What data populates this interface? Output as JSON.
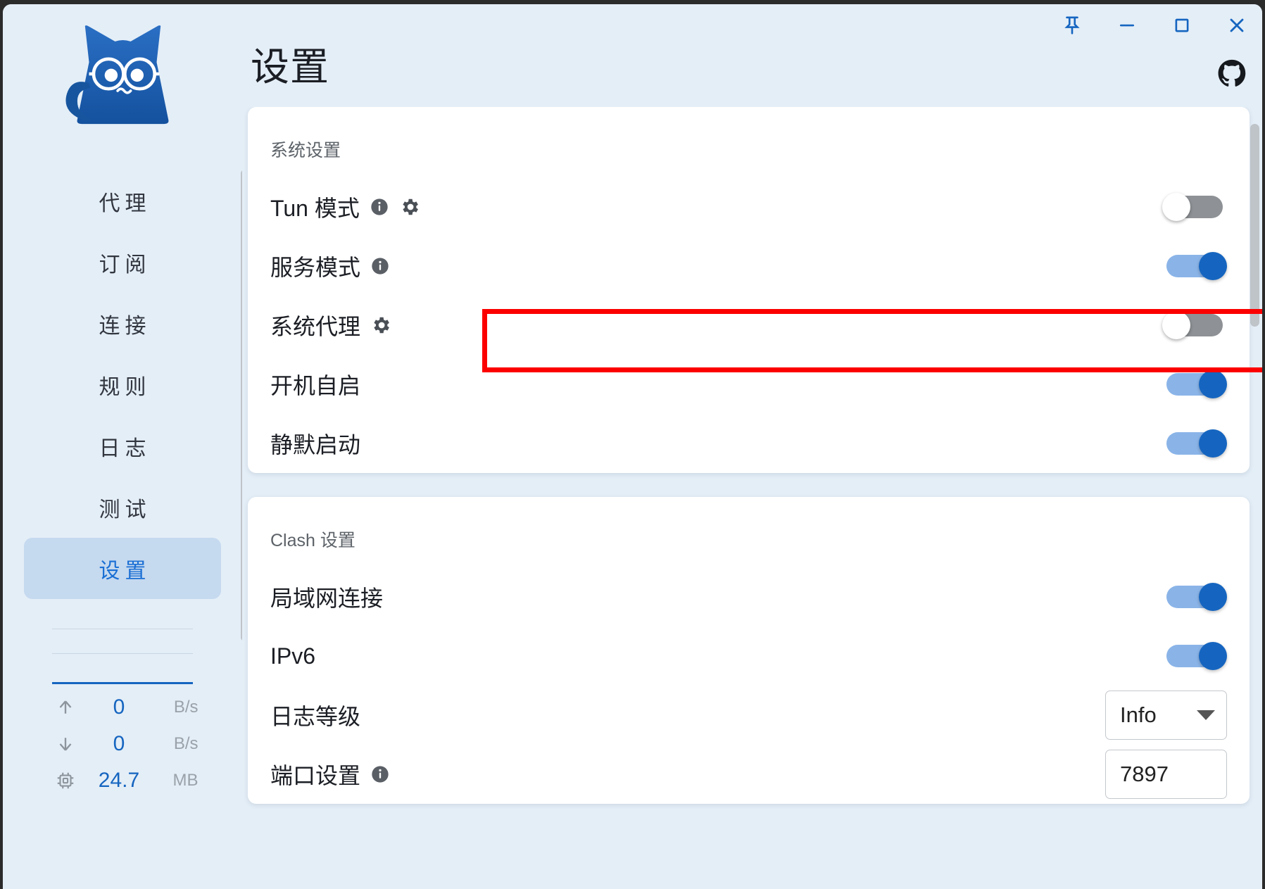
{
  "window": {
    "controls": [
      {
        "name": "pin",
        "glyph": "pin-icon"
      },
      {
        "name": "minimize",
        "glyph": "minimize-icon"
      },
      {
        "name": "maximize",
        "glyph": "maximize-icon"
      },
      {
        "name": "close",
        "glyph": "close-icon"
      }
    ],
    "github_icon": "github-icon"
  },
  "header": {
    "title": "设置"
  },
  "sidebar": {
    "logo": "clash-verge-cat-logo",
    "items": [
      {
        "label": "代理",
        "active": false
      },
      {
        "label": "订阅",
        "active": false
      },
      {
        "label": "连接",
        "active": false
      },
      {
        "label": "规则",
        "active": false
      },
      {
        "label": "日志",
        "active": false
      },
      {
        "label": "测试",
        "active": false
      },
      {
        "label": "设置",
        "active": true
      }
    ],
    "stats": [
      {
        "icon": "arrow-up-icon",
        "value": "0",
        "unit": "B/s"
      },
      {
        "icon": "arrow-down-icon",
        "value": "0",
        "unit": "B/s"
      },
      {
        "icon": "memory-chip-icon",
        "value": "24.7",
        "unit": "MB"
      }
    ]
  },
  "system_settings": {
    "title": "系统设置",
    "rows": [
      {
        "label": "Tun 模式",
        "icons": [
          "info-icon",
          "gear-icon"
        ],
        "toggle": "off",
        "highlighted": false
      },
      {
        "label": "服务模式",
        "icons": [
          "info-icon"
        ],
        "toggle": "on",
        "highlighted": false
      },
      {
        "label": "系统代理",
        "icons": [
          "gear-icon"
        ],
        "toggle": "off",
        "highlighted": true
      },
      {
        "label": "开机自启",
        "icons": [],
        "toggle": "on",
        "highlighted": false
      },
      {
        "label": "静默启动",
        "icons": [],
        "toggle": "on",
        "highlighted": false
      }
    ]
  },
  "clash_settings": {
    "title": "Clash 设置",
    "rows": [
      {
        "label": "局域网连接",
        "icons": [],
        "control": "toggle",
        "toggle": "on"
      },
      {
        "label": "IPv6",
        "icons": [],
        "control": "toggle",
        "toggle": "on"
      },
      {
        "label": "日志等级",
        "icons": [],
        "control": "select",
        "value": "Info"
      },
      {
        "label": "端口设置",
        "icons": [
          "info-icon"
        ],
        "control": "text",
        "value": "7897"
      }
    ]
  },
  "colors": {
    "accent": "#1565c0",
    "background": "#e4eef7",
    "card": "#ffffff",
    "sidebar_active": "#c5d9ef",
    "toggle_off": "#8e9296",
    "annotation": "#fc0000"
  }
}
